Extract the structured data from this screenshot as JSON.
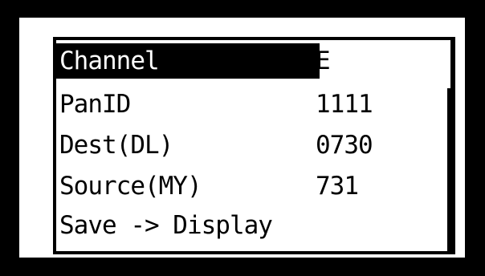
{
  "menu": {
    "items": [
      {
        "label": "Channel",
        "value": "E",
        "selected": true
      },
      {
        "label": "PanID",
        "value": "1111",
        "selected": false
      },
      {
        "label": "Dest(DL)",
        "value": "0730",
        "selected": false
      },
      {
        "label": "Source(MY)",
        "value": "731",
        "selected": false
      },
      {
        "label": "Save -> Display",
        "value": "",
        "selected": false
      }
    ]
  },
  "scrollbar": {
    "thumb_start_fraction": 0.23,
    "thumb_size_fraction": 0.77
  },
  "colors": {
    "background": "#000000",
    "screen": "#ffffff",
    "text": "#000000",
    "highlight": "#000000",
    "highlight_text": "#ffffff"
  }
}
